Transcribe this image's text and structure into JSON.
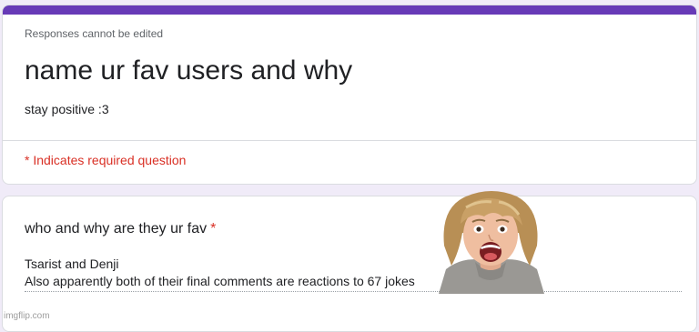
{
  "form": {
    "accent_color": "#673ab7",
    "background_color": "#f0ebf8",
    "notice": "Responses cannot be edited",
    "title": "name ur fav users and why",
    "description": "stay positive :3",
    "required_note": "* Indicates required question"
  },
  "question": {
    "title": "who and why are they ur fav",
    "required_marker": "*",
    "answer_lines": [
      "Tsarist and Denji",
      "Also apparently both of their final comments are reactions to 67 jokes"
    ]
  },
  "photo": {
    "icon": "excited-kid-photo"
  },
  "watermark": "imgflip.com"
}
